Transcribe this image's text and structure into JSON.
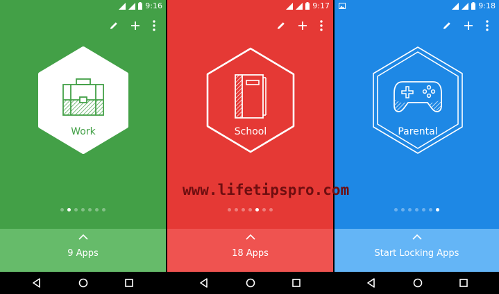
{
  "watermark": "www.lifetipspro.com",
  "colors": {
    "work_bg": "#43A047",
    "work_bottom": "#66BB6A",
    "school_bg": "#E53935",
    "school_bottom": "#EF5350",
    "parental_bg": "#1E88E5",
    "parental_bottom": "#64B5F6",
    "nav_bg": "#000000"
  },
  "panels": [
    {
      "id": "work",
      "status_time": "9:16",
      "profile_label": "Work",
      "icon": "briefcase-icon",
      "bottom_label": "9 Apps",
      "dots_total": 7,
      "dot_active": 1
    },
    {
      "id": "school",
      "status_time": "9:17",
      "profile_label": "School",
      "icon": "notebook-icon",
      "bottom_label": "18 Apps",
      "dots_total": 7,
      "dot_active": 4
    },
    {
      "id": "parental",
      "status_time": "9:18",
      "profile_label": "Parental",
      "icon": "gamepad-icon",
      "bottom_label": "Start Locking Apps",
      "dots_total": 7,
      "dot_active": 6
    }
  ]
}
